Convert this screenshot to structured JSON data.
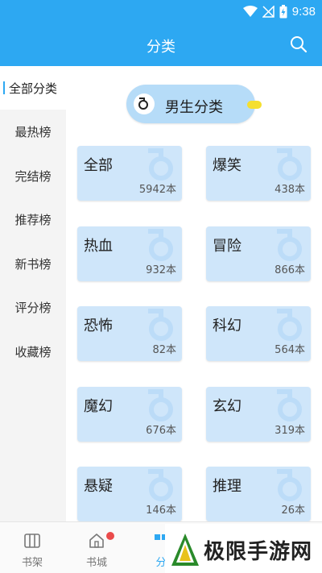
{
  "status": {
    "time": "9:38"
  },
  "header": {
    "title": "分类"
  },
  "sidebar": {
    "items": [
      {
        "label": "全部分类"
      },
      {
        "label": "最热榜"
      },
      {
        "label": "完结榜"
      },
      {
        "label": "推荐榜"
      },
      {
        "label": "新书榜"
      },
      {
        "label": "评分榜"
      },
      {
        "label": "收藏榜"
      }
    ]
  },
  "gender": {
    "label": "男生分类"
  },
  "categories": [
    {
      "name": "全部",
      "count": "5942本"
    },
    {
      "name": "爆笑",
      "count": "438本"
    },
    {
      "name": "热血",
      "count": "932本"
    },
    {
      "name": "冒险",
      "count": "866本"
    },
    {
      "name": "恐怖",
      "count": "82本"
    },
    {
      "name": "科幻",
      "count": "564本"
    },
    {
      "name": "魔幻",
      "count": "676本"
    },
    {
      "name": "玄幻",
      "count": "319本"
    },
    {
      "name": "悬疑",
      "count": "146本"
    },
    {
      "name": "推理",
      "count": "26本"
    }
  ],
  "tabs": [
    {
      "label": "书架"
    },
    {
      "label": "书城"
    },
    {
      "label": "分"
    }
  ],
  "watermark": {
    "text": "极限手游网"
  },
  "colors": {
    "primary": "#2da8f2",
    "card": "#cfe6fa",
    "pill": "#b6dcf8",
    "badge": "#ea4b4b"
  }
}
